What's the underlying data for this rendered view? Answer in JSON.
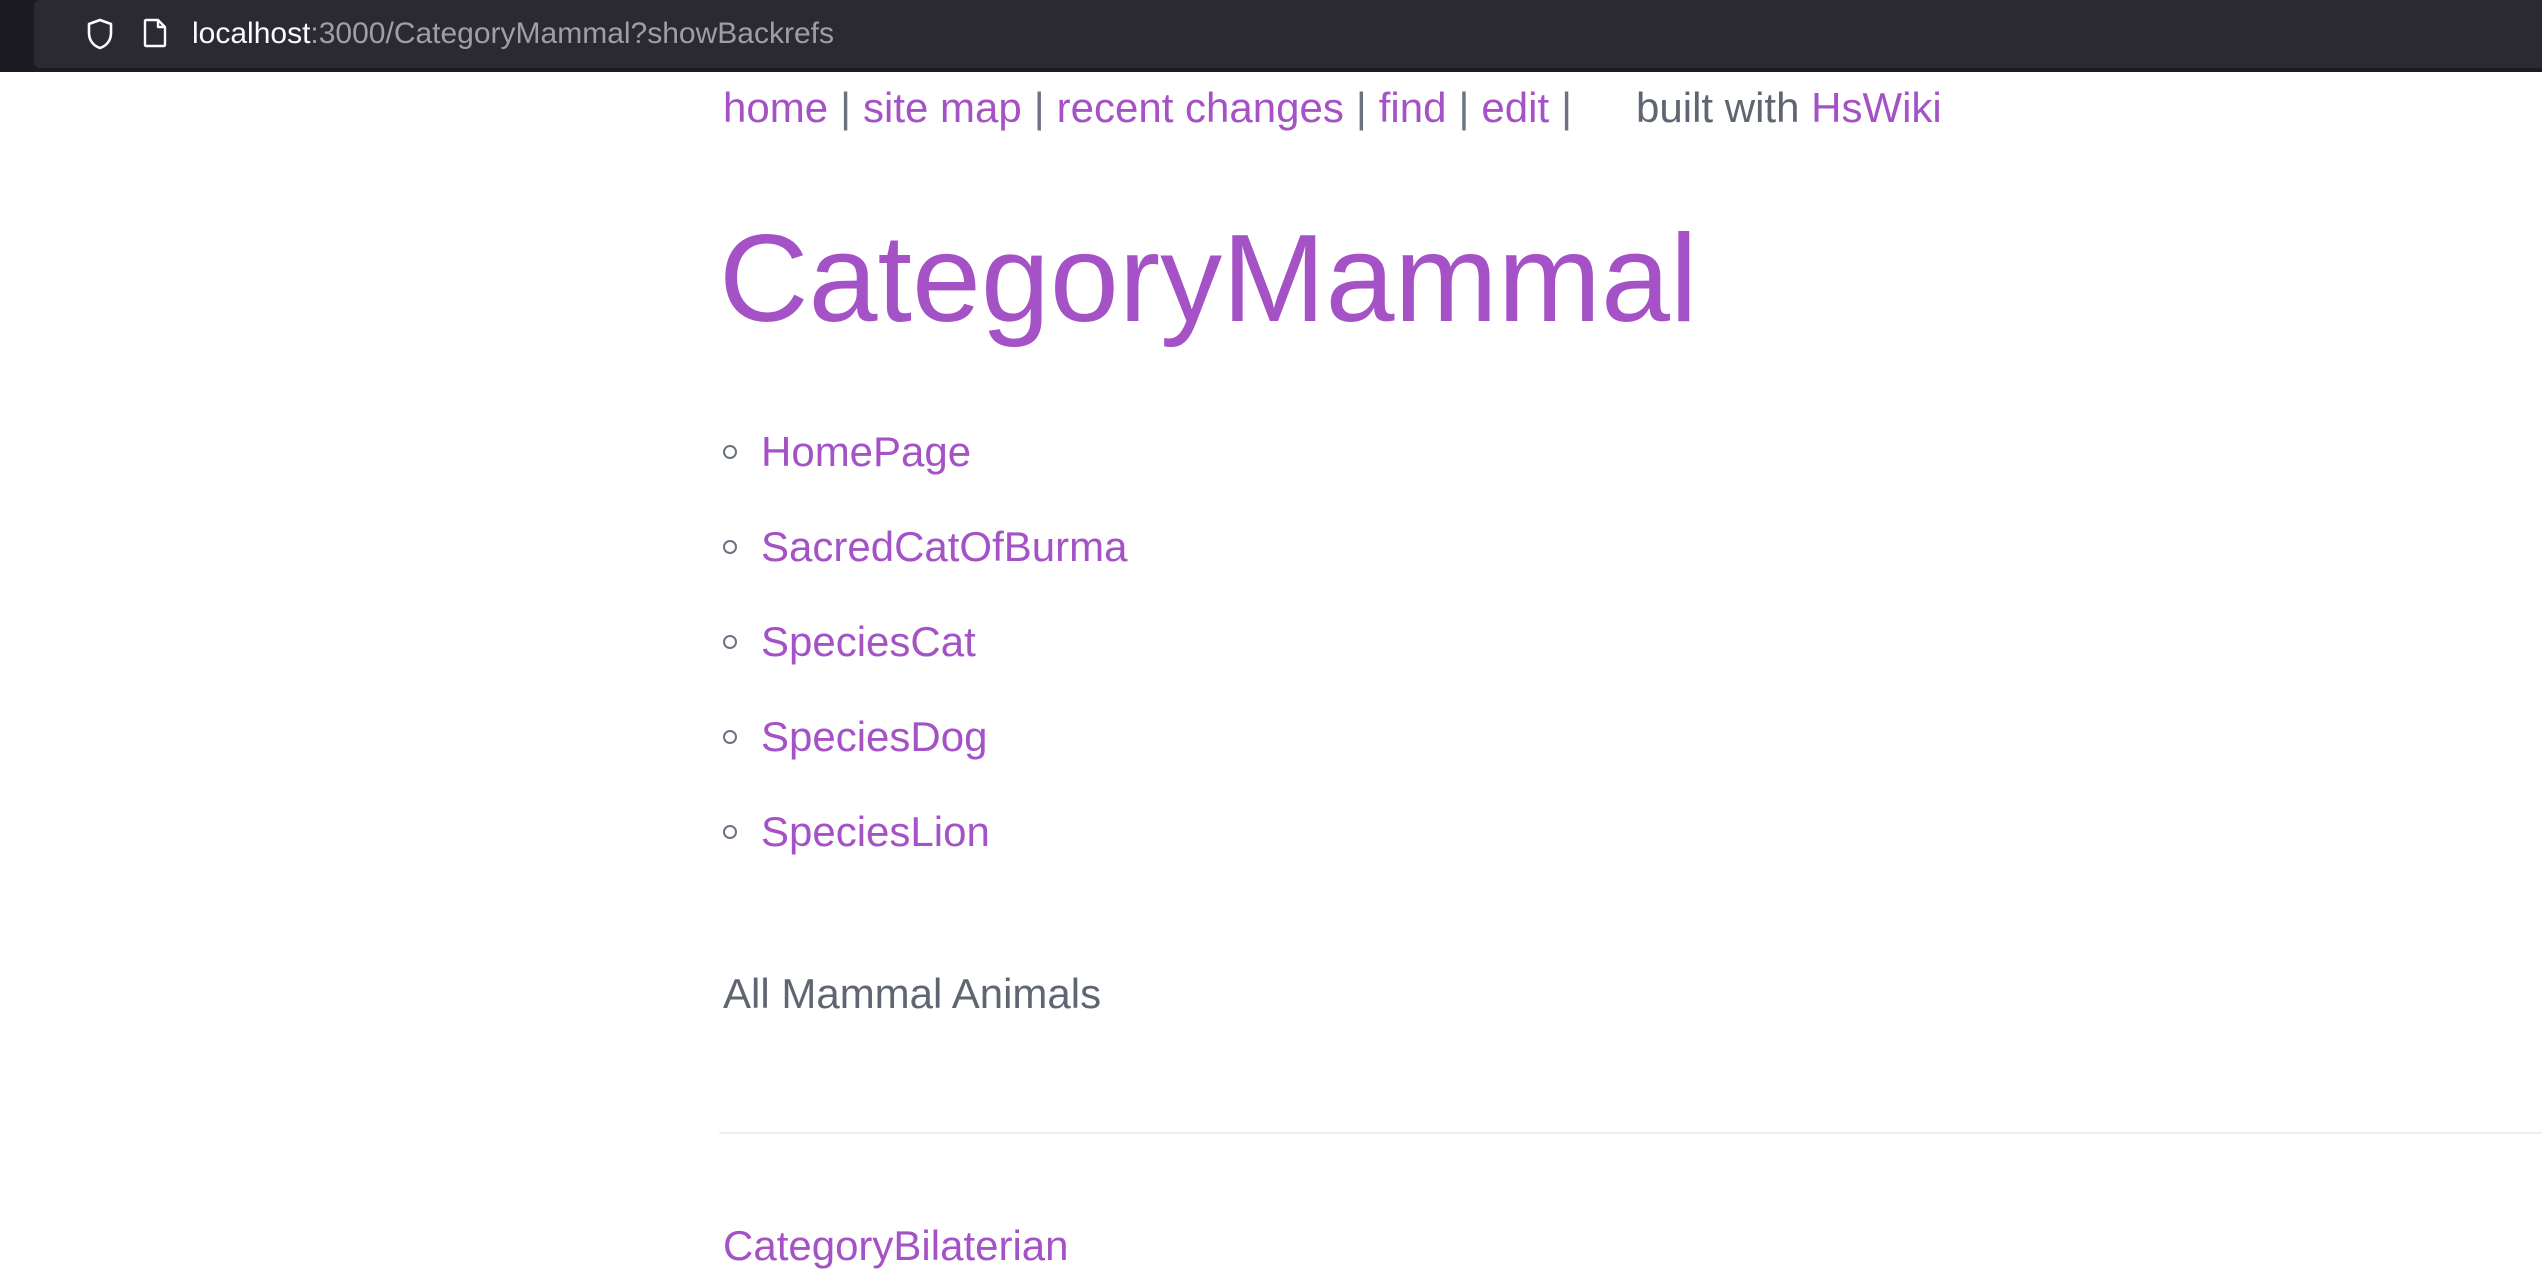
{
  "browser": {
    "url_host": "localhost",
    "url_rest": ":3000/CategoryMammal?showBackrefs",
    "icons": [
      "shield-icon",
      "page-icon"
    ]
  },
  "nav": {
    "home": "home",
    "site_map": "site map",
    "recent_changes": "recent changes",
    "find": "find",
    "edit": "edit",
    "separator": "|",
    "built_with": "built with",
    "engine": "HsWiki"
  },
  "page": {
    "title": "CategoryMammal",
    "backrefs": [
      "HomePage",
      "SacredCatOfBurma",
      "SpeciesCat",
      "SpeciesDog",
      "SpeciesLion"
    ],
    "description": "All Mammal Animals",
    "category": "CategoryBilaterian"
  },
  "colors": {
    "link": "#a452c6",
    "text": "#5f6672",
    "urlbar": "#2b2a33"
  }
}
